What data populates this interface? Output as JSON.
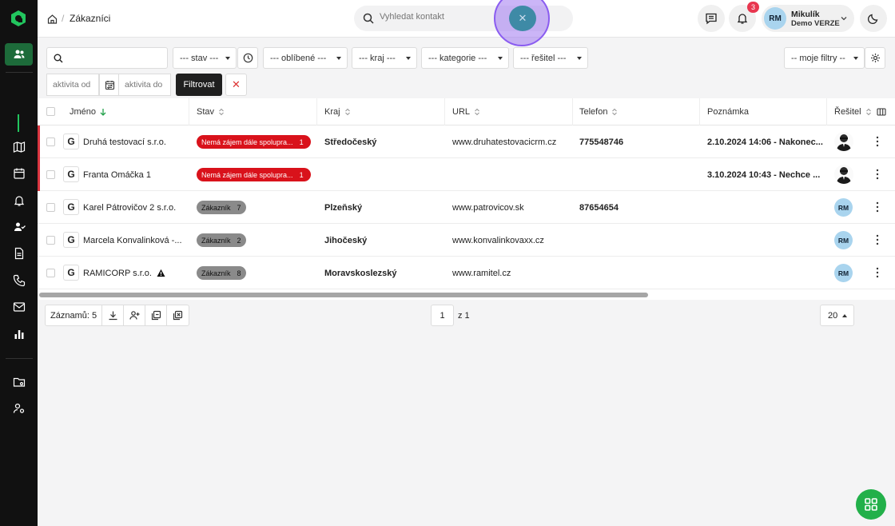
{
  "breadcrumb": {
    "current": "Zákazníci"
  },
  "search": {
    "placeholder": "Vyhledat kontakt"
  },
  "notifications": {
    "count": "3"
  },
  "user": {
    "initials": "RM",
    "name": "Mikulík",
    "org": "Demo VERZE"
  },
  "filters": {
    "stav": "--- stav ---",
    "oblibene": "--- oblíbené ---",
    "kraj": "--- kraj ---",
    "kategorie": "--- kategorie ---",
    "resitel": "--- řešitel ---",
    "moje_filtry": "-- moje filtry --",
    "aktivita_od": "aktivita od",
    "aktivita_do": "aktivita do",
    "filter_button": "Filtrovat"
  },
  "table": {
    "columns": [
      "Jméno",
      "Stav",
      "Kraj",
      "URL",
      "Telefon",
      "Poznámka",
      "Řešitel"
    ],
    "rows": [
      {
        "name": "Druhá testovací s.r.o.",
        "status": "Nemá zájem dále spolupra...",
        "status_count": "1",
        "kraj": "Středočeský",
        "url": "www.druhatestovacicrm.cz",
        "phone": "775548746",
        "note": "2.10.2024 14:06 - Nakonec...",
        "assignee": ""
      },
      {
        "name": "Franta Omáčka 1",
        "status": "Nemá zájem dále spolupra...",
        "status_count": "1",
        "kraj": "",
        "url": "",
        "phone": "",
        "note": "3.10.2024 10:43 - Nechce ...",
        "assignee": ""
      },
      {
        "name": "Karel Pátrovičov 2 s.r.o.",
        "status": "Zákazník",
        "status_count": "7",
        "kraj": "Plzeňský",
        "url": "www.patrovicov.sk",
        "phone": "87654654",
        "note": "",
        "assignee": "RM"
      },
      {
        "name": "Marcela Konvalinková -...",
        "status": "Zákazník",
        "status_count": "2",
        "kraj": "Jihočeský",
        "url": "www.konvalinkovaxx.cz",
        "phone": "",
        "note": "",
        "assignee": "RM"
      },
      {
        "name": "RAMICORP s.r.o.",
        "status": "Zákazník",
        "status_count": "8",
        "kraj": "Moravskoslezský",
        "url": "www.ramitel.cz",
        "phone": "",
        "note": "",
        "assignee": "RM"
      }
    ]
  },
  "footer": {
    "records": "Záznamů: 5",
    "page": "1",
    "page_of": "z 1",
    "page_size": "20"
  },
  "colors": {
    "accent": "#22b04a",
    "danger": "#d9121b",
    "sidebar": "#111111"
  }
}
